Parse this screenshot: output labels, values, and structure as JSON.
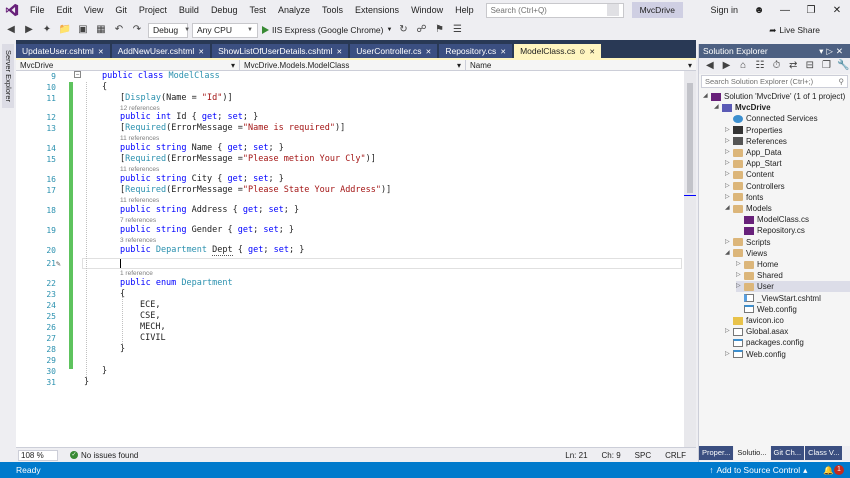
{
  "menu": [
    "File",
    "Edit",
    "View",
    "Git",
    "Project",
    "Build",
    "Debug",
    "Test",
    "Analyze",
    "Tools",
    "Extensions",
    "Window",
    "Help"
  ],
  "search": {
    "placeholder": "Search (Ctrl+Q)"
  },
  "solution_name": "MvcDrive",
  "signin": "Sign in",
  "toolbar": {
    "config": "Debug",
    "platform": "Any CPU",
    "run_target": "IIS Express (Google Chrome)",
    "live_share": "Live Share"
  },
  "left_strip": {
    "server_explorer": "Server Explorer"
  },
  "doc_tabs": [
    {
      "label": "UpdateUser.cshtml",
      "active": false
    },
    {
      "label": "AddNewUser.cshtml",
      "active": false
    },
    {
      "label": "ShowListOfUserDetails.cshtml",
      "active": false
    },
    {
      "label": "UserController.cs",
      "active": false
    },
    {
      "label": "Repository.cs",
      "active": false
    },
    {
      "label": "ModelClass.cs",
      "active": true
    }
  ],
  "navbar": {
    "project": "MvcDrive",
    "type": "MvcDrive.Models.ModelClass",
    "member": "Name"
  },
  "code": {
    "l9": "public class ModelClass",
    "l10": "{",
    "l11": "[Display(Name = \"Id\")]",
    "ref12": "12 references",
    "l12": "public int Id { get; set; }",
    "l13": "[Required(ErrorMessage =\"Name is required\")]",
    "ref14": "11 references",
    "l14": "public string Name { get; set; }",
    "l15": "[Required(ErrorMessage =\"Please metion Your Cly\")]",
    "ref16": "11 references",
    "l16": "public string City { get; set; }",
    "l17": "[Required(ErrorMessage =\"Please State Your Address\")]",
    "ref18": "11 references",
    "l18": "public string Address { get; set; }",
    "ref19": "7 references",
    "l19": "public string Gender { get; set; }",
    "ref20": "3 references",
    "l20": "public Department Dept { get; set; }",
    "l21": "",
    "ref22": "1 reference",
    "l22": "public enum Department",
    "l23": "{",
    "l24": "ECE,",
    "l25": "CSE,",
    "l26": "MECH,",
    "l27": "CIVIL",
    "l28": "}",
    "l30": "}",
    "l31": "}"
  },
  "line_numbers": [
    "9",
    "10",
    "11",
    "12",
    "13",
    "14",
    "15",
    "16",
    "17",
    "18",
    "19",
    "20",
    "21",
    "22",
    "23",
    "24",
    "25",
    "26",
    "27",
    "28",
    "29",
    "30",
    "31"
  ],
  "editor_status": {
    "zoom": "108 %",
    "issues": "No issues found",
    "ln": "Ln: 21",
    "ch": "Ch: 9",
    "spc": "SPC",
    "crlf": "CRLF"
  },
  "solution_explorer": {
    "title": "Solution Explorer",
    "search_placeholder": "Search Solution Explorer (Ctrl+;)",
    "items": [
      {
        "label": "Solution 'MvcDrive' (1 of 1 project)",
        "indent": 0,
        "icon": "sol"
      },
      {
        "label": "MvcDrive",
        "indent": 1,
        "icon": "proj",
        "bold": true
      },
      {
        "label": "Connected Services",
        "indent": 2,
        "icon": "svc"
      },
      {
        "label": "Properties",
        "indent": 2,
        "icon": "wrench"
      },
      {
        "label": "References",
        "indent": 2,
        "icon": "ref"
      },
      {
        "label": "App_Data",
        "indent": 2,
        "icon": "folder"
      },
      {
        "label": "App_Start",
        "indent": 2,
        "icon": "folder"
      },
      {
        "label": "Content",
        "indent": 2,
        "icon": "folder"
      },
      {
        "label": "Controllers",
        "indent": 2,
        "icon": "folder"
      },
      {
        "label": "fonts",
        "indent": 2,
        "icon": "folder"
      },
      {
        "label": "Models",
        "indent": 2,
        "icon": "folder"
      },
      {
        "label": "ModelClass.cs",
        "indent": 3,
        "icon": "cs"
      },
      {
        "label": "Repository.cs",
        "indent": 3,
        "icon": "cs"
      },
      {
        "label": "Scripts",
        "indent": 2,
        "icon": "folder"
      },
      {
        "label": "Views",
        "indent": 2,
        "icon": "folder"
      },
      {
        "label": "Home",
        "indent": 3,
        "icon": "folder"
      },
      {
        "label": "Shared",
        "indent": 3,
        "icon": "folder"
      },
      {
        "label": "User",
        "indent": 3,
        "icon": "folder",
        "selected": true
      },
      {
        "label": "_ViewStart.cshtml",
        "indent": 3,
        "icon": "razor"
      },
      {
        "label": "Web.config",
        "indent": 3,
        "icon": "config"
      },
      {
        "label": "favicon.ico",
        "indent": 2,
        "icon": "ico"
      },
      {
        "label": "Global.asax",
        "indent": 2,
        "icon": "file"
      },
      {
        "label": "packages.config",
        "indent": 2,
        "icon": "config"
      },
      {
        "label": "Web.config",
        "indent": 2,
        "icon": "config"
      }
    ],
    "tabs": [
      "Proper...",
      "Solutio...",
      "Git Ch...",
      "Class V..."
    ]
  },
  "status": {
    "ready": "Ready",
    "source_control": "Add to Source Control",
    "notifications": "1"
  },
  "colors": {
    "accent": "#007acc",
    "title_bar": "#eeeef2",
    "tab_active": "#fff5c0"
  }
}
